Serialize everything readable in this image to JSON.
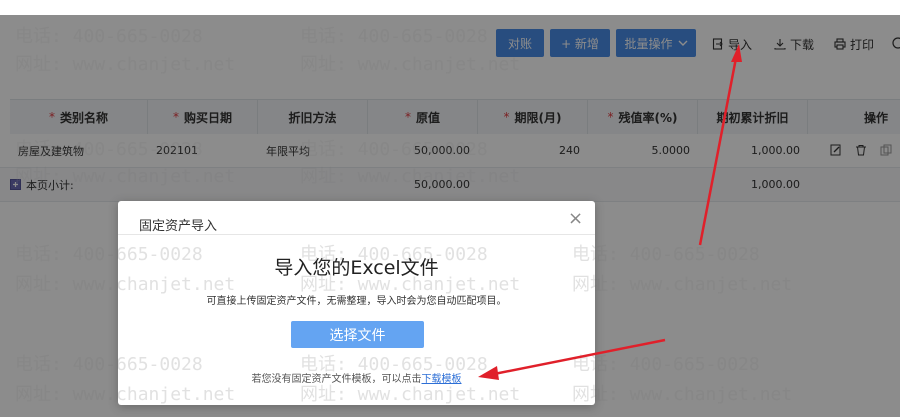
{
  "toolbar": {
    "reconcile": "对账",
    "add": "+ 新增",
    "batch": "批量操作",
    "import": "导入",
    "download": "下载",
    "print": "打印"
  },
  "table": {
    "columns": [
      "类别名称",
      "购买日期",
      "折旧方法",
      "原值",
      "期限(月)",
      "残值率(%)",
      "期初累计折旧",
      "操作"
    ],
    "required": [
      true,
      true,
      false,
      true,
      true,
      true,
      false,
      false
    ],
    "rows": [
      {
        "category": "房屋及建筑物",
        "date": "202101",
        "method": "年限平均",
        "original": "50,000.00",
        "term": "240",
        "residual": "5.0000",
        "accum": "1,000.00"
      }
    ],
    "subtotal": {
      "label": "本页小计:",
      "original": "50,000.00",
      "accum": "1,000.00"
    }
  },
  "dialog": {
    "title": "固定资产导入",
    "close": "×",
    "heading": "导入您的Excel文件",
    "description": "可直接上传固定资产文件，无需整理，导入时会为您自动匹配项目。",
    "button": "选择文件",
    "hint": "若您没有固定资产文件模板，可以点击",
    "link": "下载模板"
  },
  "watermark": {
    "phone": "电话: 400-665-0028",
    "site": "网址: www.chanjet.net"
  },
  "colors": {
    "primary": "#4a8de8",
    "dialog_button": "#64a4f2",
    "link": "#2d6fd6",
    "required": "#e0393e",
    "annotation_arrow": "#e0202a"
  }
}
